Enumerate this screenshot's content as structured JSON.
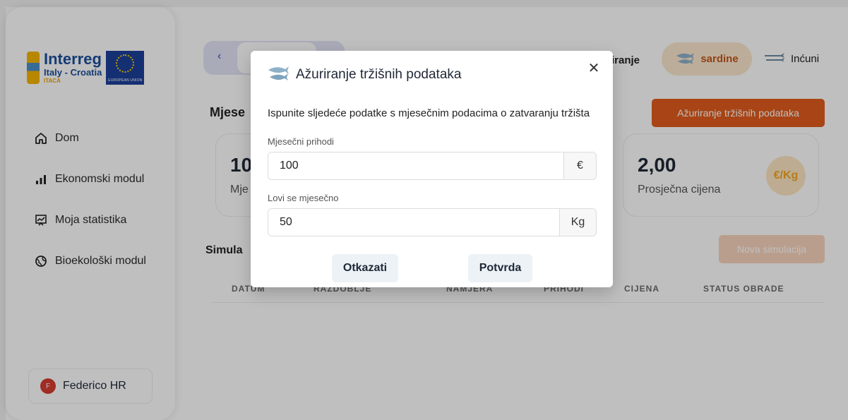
{
  "logo": {
    "title": "Interreg",
    "subtitle": "Italy - Croatia",
    "program": "ITACA",
    "eu_label": "EUROPEAN UNION"
  },
  "sidebar": {
    "items": [
      {
        "label": "Dom",
        "icon": "home-icon"
      },
      {
        "label": "Ekonomski modul",
        "icon": "bar-chart-icon"
      },
      {
        "label": "Moja statistika",
        "icon": "stats-chart-icon"
      },
      {
        "label": "Bioekološki modul",
        "icon": "globe-icon"
      }
    ],
    "user": {
      "initial": "F",
      "name": "Federico HR"
    }
  },
  "header": {
    "back_icon": "chevron-left-icon",
    "species_partial": "iranje",
    "species_selected": "sardine",
    "species_other": "Inćuni"
  },
  "main": {
    "section_title": "Mjese",
    "update_button": "Ažuriranje tržišnih podataka",
    "cards": [
      {
        "value": "10",
        "label": "Mje"
      },
      {
        "value": "2,00",
        "label": "Prosječna cijena",
        "badge": "€/Kg"
      }
    ],
    "simulation_title": "Simula",
    "new_simulation_button": "Nova simulacija",
    "table_headers": [
      "DATUM",
      "RAZDOBLJE",
      "NAMJERA",
      "PRIHODI",
      "CIJENA",
      "STATUS OBRADE"
    ]
  },
  "modal": {
    "title": "Ažuriranje tržišnih podataka",
    "description": "Ispunite sljedeće podatke s mjesečnim podacima o zatvaranju tržišta",
    "fields": [
      {
        "label": "Mjesečni prihodi",
        "value": "100",
        "unit": "€"
      },
      {
        "label": "Lovi se mjesečno",
        "value": "50",
        "unit": "Kg"
      }
    ],
    "cancel": "Otkazati",
    "confirm": "Potvrda"
  },
  "colors": {
    "accent": "#e05b1c",
    "accent_light": "#f8d3bc",
    "badge": "#f5a623"
  }
}
